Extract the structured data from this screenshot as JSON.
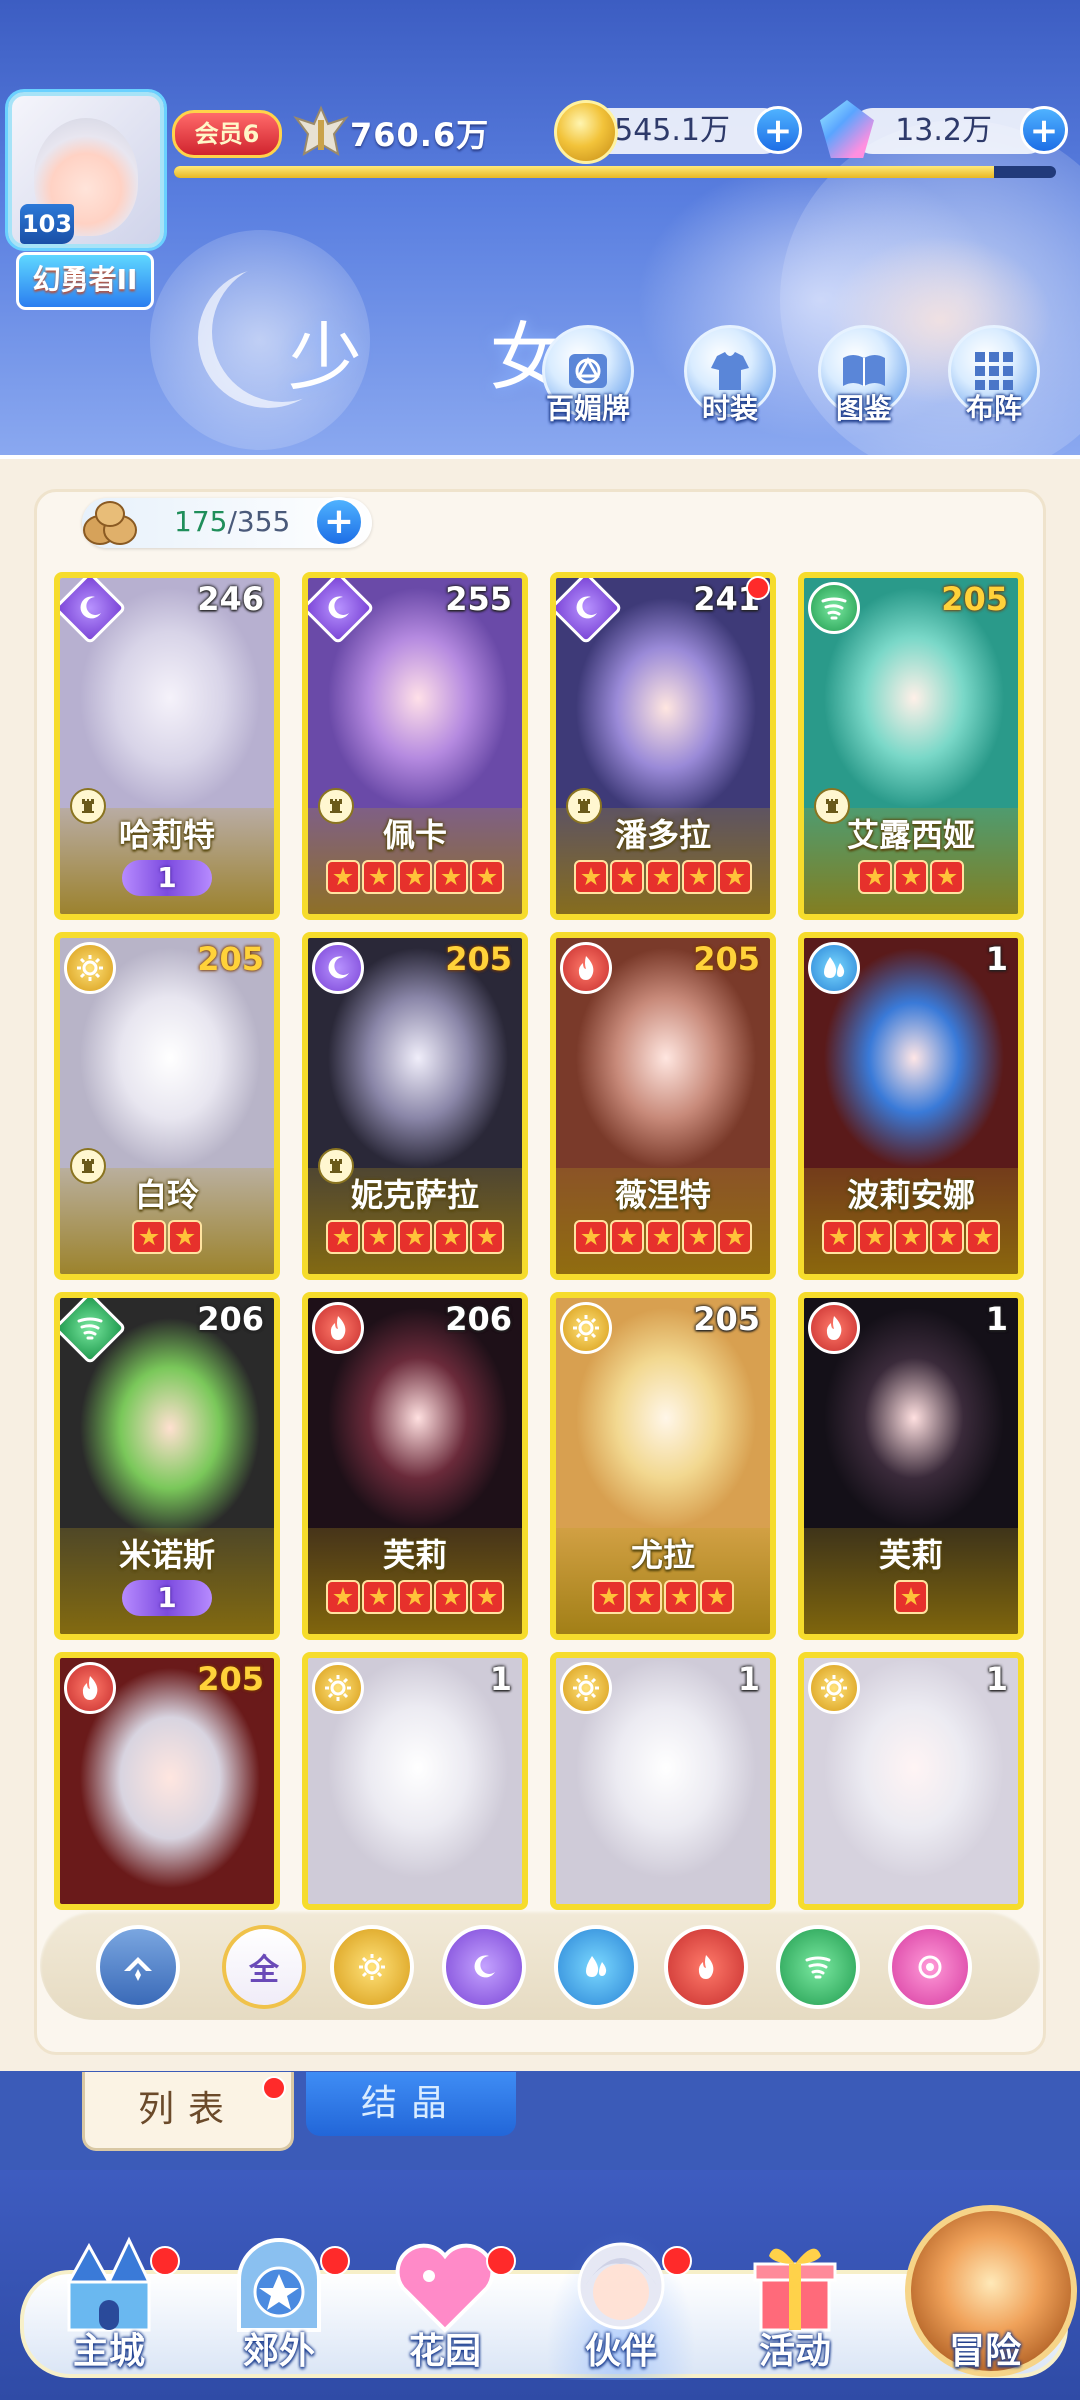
{
  "header": {
    "player_level": "103",
    "player_title": "幻勇者II",
    "vip_label": "会员6",
    "power": "760.6万",
    "gold": "545.1万",
    "gems": "13.2万",
    "exp_progress": 0.93,
    "page_title": "少 女"
  },
  "top_menu": [
    {
      "label": "百媚牌",
      "icon": "card-deck-icon"
    },
    {
      "label": "时装",
      "icon": "outfit-icon"
    },
    {
      "label": "图鉴",
      "icon": "codex-icon"
    },
    {
      "label": "布阵",
      "icon": "formation-grid-icon"
    }
  ],
  "collection": {
    "current": "175",
    "total": "/355"
  },
  "cards": [
    {
      "name": "哈莉特",
      "level": "246",
      "element": "moon",
      "diamond": true,
      "awaken": "1",
      "stars": 0,
      "tower": true,
      "level_gold": false
    },
    {
      "name": "佩卡",
      "level": "255",
      "element": "moon",
      "diamond": true,
      "awaken": "",
      "stars": 5,
      "tower": true,
      "level_gold": false
    },
    {
      "name": "潘多拉",
      "level": "241",
      "element": "moon",
      "diamond": true,
      "awaken": "",
      "stars": 5,
      "tower": true,
      "level_gold": false,
      "red_dot": true
    },
    {
      "name": "艾露西娅",
      "level": "205",
      "element": "wind",
      "diamond": false,
      "awaken": "",
      "stars": 3,
      "tower": true,
      "level_gold": true
    },
    {
      "name": "白玲",
      "level": "205",
      "element": "sun",
      "diamond": false,
      "awaken": "",
      "stars": 2,
      "tower": true,
      "level_gold": true
    },
    {
      "name": "妮克萨拉",
      "level": "205",
      "element": "moon",
      "diamond": false,
      "awaken": "",
      "stars": 5,
      "tower": true,
      "level_gold": true
    },
    {
      "name": "薇涅特",
      "level": "205",
      "element": "fire",
      "diamond": false,
      "awaken": "",
      "stars": 5,
      "tower": false,
      "level_gold": true
    },
    {
      "name": "波莉安娜",
      "level": "1",
      "element": "water",
      "diamond": false,
      "awaken": "",
      "stars": 5,
      "tower": false,
      "level_gold": false
    },
    {
      "name": "米诺斯",
      "level": "206",
      "element": "wind",
      "diamond": true,
      "awaken": "1",
      "stars": 0,
      "tower": false,
      "level_gold": false
    },
    {
      "name": "芙莉",
      "level": "206",
      "element": "fire",
      "diamond": false,
      "awaken": "",
      "stars": 5,
      "tower": false,
      "level_gold": false
    },
    {
      "name": "尤拉",
      "level": "205",
      "element": "sun",
      "diamond": false,
      "awaken": "",
      "stars": 4,
      "tower": false,
      "level_gold": false
    },
    {
      "name": "芙莉",
      "level": "1",
      "element": "fire",
      "diamond": false,
      "awaken": "",
      "stars": 1,
      "tower": false,
      "level_gold": false
    },
    {
      "name": "",
      "level": "205",
      "element": "fire",
      "diamond": false,
      "awaken": "",
      "stars": 0,
      "tower": false,
      "level_gold": true
    },
    {
      "name": "",
      "level": "1",
      "element": "sun",
      "diamond": false,
      "awaken": "",
      "stars": 0,
      "tower": false,
      "level_gold": false
    },
    {
      "name": "",
      "level": "1",
      "element": "sun",
      "diamond": false,
      "awaken": "",
      "stars": 0,
      "tower": false,
      "level_gold": false
    },
    {
      "name": "",
      "level": "1",
      "element": "sun",
      "diamond": false,
      "awaken": "",
      "stars": 0,
      "tower": false,
      "level_gold": false
    }
  ],
  "filters": [
    {
      "id": "class",
      "label": ""
    },
    {
      "id": "all",
      "label": "全"
    },
    {
      "id": "sun",
      "label": ""
    },
    {
      "id": "moon",
      "label": ""
    },
    {
      "id": "water",
      "label": ""
    },
    {
      "id": "fire",
      "label": ""
    },
    {
      "id": "wind",
      "label": ""
    },
    {
      "id": "pink",
      "label": ""
    }
  ],
  "tabs": {
    "list": "列表",
    "crystal": "结晶"
  },
  "nav": [
    {
      "label": "主城",
      "icon": "castle-icon",
      "dot": true
    },
    {
      "label": "郊外",
      "icon": "portal-icon",
      "dot": true
    },
    {
      "label": "花园",
      "icon": "heart-icon",
      "dot": true
    },
    {
      "label": "伙伴",
      "icon": "partner-icon",
      "dot": true,
      "active": true
    },
    {
      "label": "活动",
      "icon": "gift-icon",
      "dot": false
    },
    {
      "label": "冒险",
      "icon": "adventure-icon",
      "dot": false
    }
  ],
  "colors": {
    "card_border": "#f6dc2c",
    "star_red": "#e6312c",
    "accent_blue": "#1d6ee6"
  }
}
